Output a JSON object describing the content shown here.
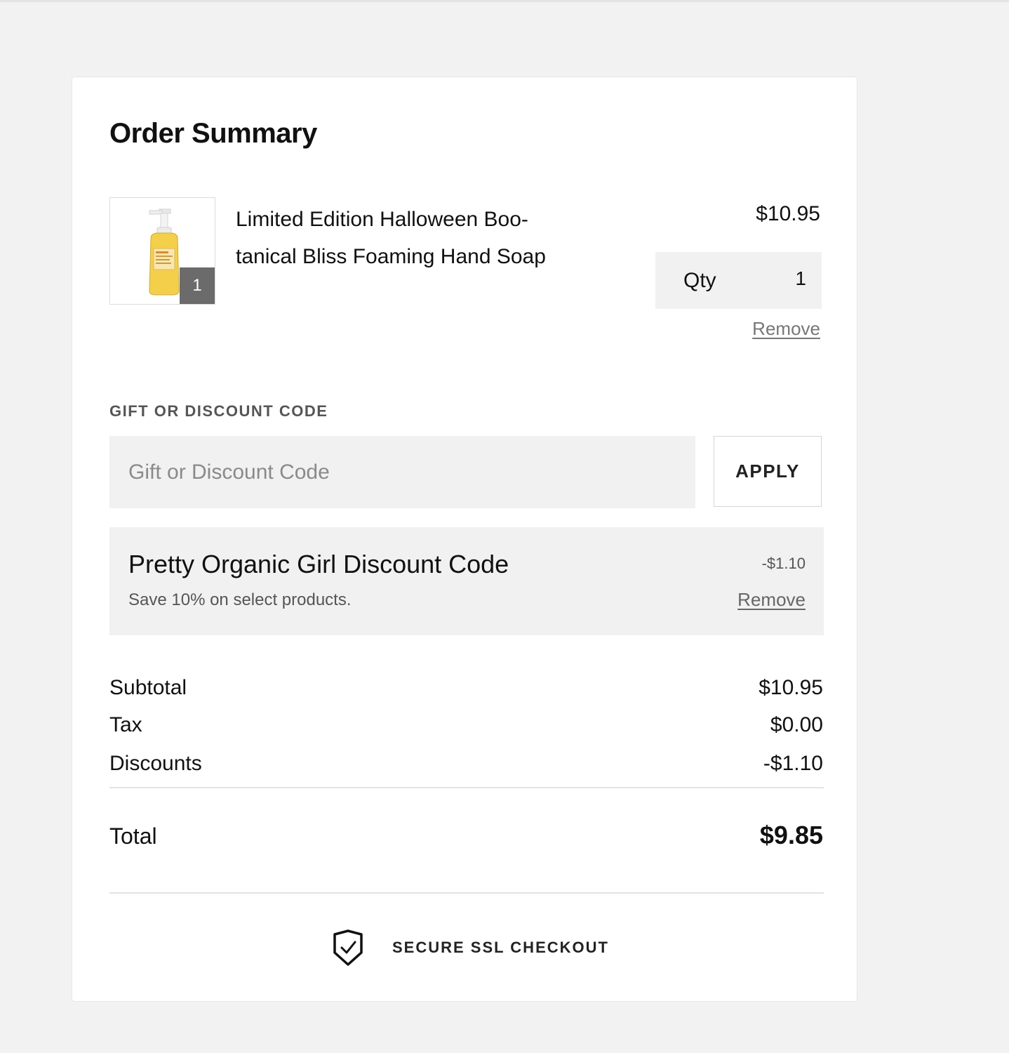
{
  "order_summary": {
    "title": "Order Summary"
  },
  "item": {
    "name": "Limited Edition Halloween Boo-tanical Bliss Foaming Hand Soap",
    "name_line1": "Limited Edition Halloween Boo-",
    "name_line2": "tanical Bliss Foaming Hand Soap",
    "price": "$10.95",
    "badge_count": "1",
    "qty_label": "Qty",
    "qty_value": "1",
    "remove_label": "Remove",
    "image_icon": "hand-soap-bottle"
  },
  "discount": {
    "section_label": "GIFT OR DISCOUNT CODE",
    "input_placeholder": "Gift or Discount Code",
    "input_value": "",
    "apply_label": "APPLY"
  },
  "applied_code": {
    "name": "Pretty Organic Girl Discount Code",
    "description": "Save 10% on select products.",
    "amount": "-$1.10",
    "remove_label": "Remove"
  },
  "totals": {
    "subtotal_label": "Subtotal",
    "subtotal_value": "$10.95",
    "tax_label": "Tax",
    "tax_value": "$0.00",
    "discounts_label": "Discounts",
    "discounts_value": "-$1.10",
    "total_label": "Total",
    "total_value": "$9.85"
  },
  "secure": {
    "label": "SECURE SSL CHECKOUT",
    "icon": "shield-check-icon"
  },
  "colors": {
    "page_background": "#f2f2f2",
    "card_background": "#ffffff",
    "field_background": "#f1f1f1",
    "badge_background": "#6b6b6b",
    "text": "#111111",
    "muted_text": "#777777"
  }
}
